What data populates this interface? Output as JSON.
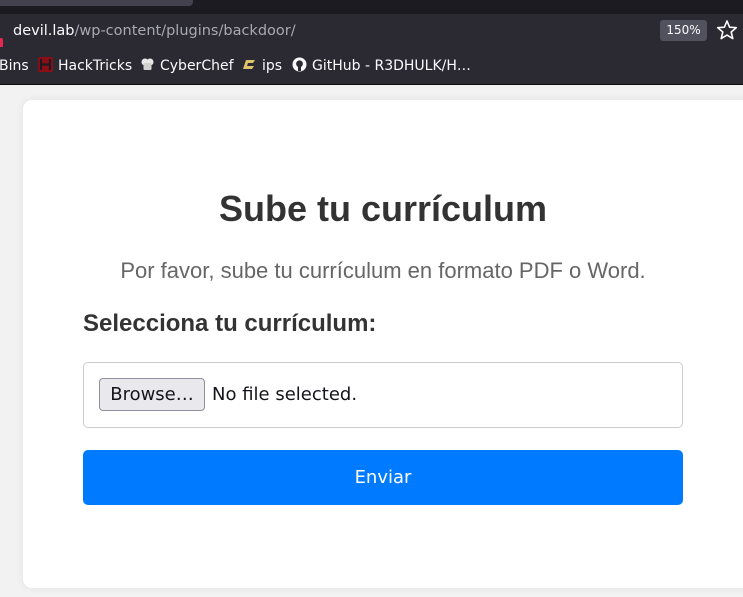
{
  "browser": {
    "url_host": "devil.lab",
    "url_path": "/wp-content/plugins/backdoor/",
    "zoom": "150%",
    "bookmarks": [
      {
        "label": "Bins",
        "icon": "none"
      },
      {
        "label": "HackTricks",
        "icon": "hacktricks-icon"
      },
      {
        "label": "CyberChef",
        "icon": "cyberchef-icon"
      },
      {
        "label": "ips",
        "icon": "ips-icon"
      },
      {
        "label": "GitHub - R3DHULK/H…",
        "icon": "github-icon"
      }
    ]
  },
  "page": {
    "title": "Sube tu currículum",
    "subtitle": "Por favor, sube tu currículum en formato PDF o Word.",
    "file_label": "Selecciona tu currículum:",
    "browse_label": "Browse…",
    "file_status": "No file selected.",
    "submit_label": "Enviar"
  },
  "colors": {
    "accent": "#007bff",
    "browser_chrome": "#2b2a33"
  }
}
